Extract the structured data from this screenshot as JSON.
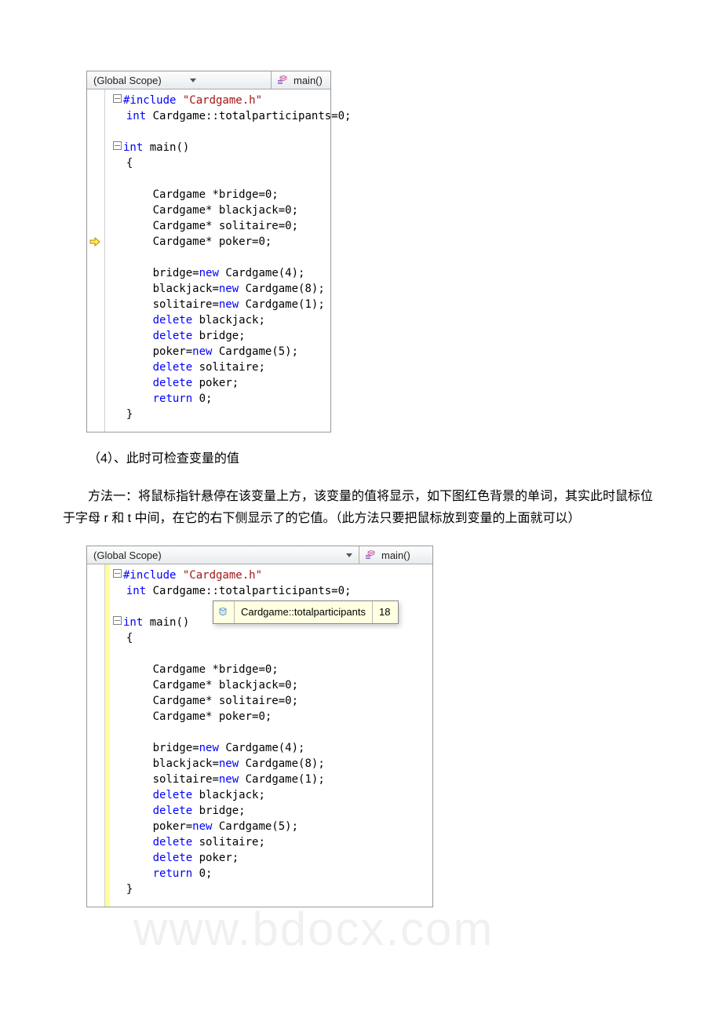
{
  "ide1": {
    "scope": "(Global Scope)",
    "member": "main()",
    "arrow_line": 9,
    "code_lines": [
      {
        "outline": true,
        "spans": [
          {
            "t": "#include ",
            "c": "kw"
          },
          {
            "t": "\"Cardgame.h\"",
            "c": "str"
          }
        ]
      },
      {
        "spans": [
          {
            "t": " ",
            "c": ""
          },
          {
            "t": "int",
            "c": "kw"
          },
          {
            "t": " Cardgame::totalparticipants=0;",
            "c": ""
          }
        ]
      },
      {
        "spans": [
          {
            "t": " ",
            "c": ""
          }
        ]
      },
      {
        "outline": true,
        "spans": [
          {
            "t": "int",
            "c": "kw"
          },
          {
            "t": " main()",
            "c": ""
          }
        ]
      },
      {
        "spans": [
          {
            "t": " {",
            "c": ""
          }
        ]
      },
      {
        "spans": [
          {
            "t": "",
            "c": ""
          }
        ]
      },
      {
        "spans": [
          {
            "t": "     Cardgame *bridge=0;",
            "c": ""
          }
        ]
      },
      {
        "spans": [
          {
            "t": "     Cardgame* blackjack=0;",
            "c": ""
          }
        ]
      },
      {
        "spans": [
          {
            "t": "     Cardgame* solitaire=0;",
            "c": ""
          }
        ]
      },
      {
        "spans": [
          {
            "t": "     Cardgame* poker=0;",
            "c": ""
          }
        ]
      },
      {
        "spans": [
          {
            "t": "",
            "c": ""
          }
        ]
      },
      {
        "spans": [
          {
            "t": "     bridge=",
            "c": ""
          },
          {
            "t": "new",
            "c": "kw"
          },
          {
            "t": " Cardgame(4);",
            "c": ""
          }
        ]
      },
      {
        "spans": [
          {
            "t": "     blackjack=",
            "c": ""
          },
          {
            "t": "new",
            "c": "kw"
          },
          {
            "t": " Cardgame(8);",
            "c": ""
          }
        ]
      },
      {
        "spans": [
          {
            "t": "     solitaire=",
            "c": ""
          },
          {
            "t": "new",
            "c": "kw"
          },
          {
            "t": " Cardgame(1);",
            "c": ""
          }
        ]
      },
      {
        "spans": [
          {
            "t": "     ",
            "c": ""
          },
          {
            "t": "delete",
            "c": "kw"
          },
          {
            "t": " blackjack;",
            "c": ""
          }
        ]
      },
      {
        "spans": [
          {
            "t": "     ",
            "c": ""
          },
          {
            "t": "delete",
            "c": "kw"
          },
          {
            "t": " bridge;",
            "c": ""
          }
        ]
      },
      {
        "spans": [
          {
            "t": "     poker=",
            "c": ""
          },
          {
            "t": "new",
            "c": "kw"
          },
          {
            "t": " Cardgame(5);",
            "c": ""
          }
        ]
      },
      {
        "spans": [
          {
            "t": "     ",
            "c": ""
          },
          {
            "t": "delete",
            "c": "kw"
          },
          {
            "t": " solitaire;",
            "c": ""
          }
        ]
      },
      {
        "spans": [
          {
            "t": "     ",
            "c": ""
          },
          {
            "t": "delete",
            "c": "kw"
          },
          {
            "t": " poker;",
            "c": ""
          }
        ]
      },
      {
        "spans": [
          {
            "t": "     ",
            "c": ""
          },
          {
            "t": "return",
            "c": "kw"
          },
          {
            "t": " 0;",
            "c": ""
          }
        ]
      },
      {
        "spans": [
          {
            "t": " }",
            "c": ""
          }
        ]
      }
    ]
  },
  "para1": "（4）、此时可检查变量的值",
  "para2": "方法一：将鼠标指针悬停在该变量上方，该变量的值将显示，如下图红色背景的单词，其实此时鼠标位于字母 r 和 t 中间，在它的右下侧显示了的它值。（此方法只要把鼠标放到变量的上面就可以）",
  "ide2": {
    "scope": "(Global Scope)",
    "member": "main()",
    "tooltip_text": "Cardgame::totalparticipants",
    "tooltip_val": "18",
    "code_lines": [
      {
        "outline": true,
        "spans": [
          {
            "t": "#include ",
            "c": "kw"
          },
          {
            "t": "\"Cardgame.h\"",
            "c": "str"
          }
        ]
      },
      {
        "spans": [
          {
            "t": " ",
            "c": ""
          },
          {
            "t": "int",
            "c": "kw"
          },
          {
            "t": " Cardgame::totalparticipants=0;",
            "c": ""
          }
        ]
      },
      {
        "spans": [
          {
            "t": " ",
            "c": ""
          }
        ]
      },
      {
        "outline": true,
        "spans": [
          {
            "t": "int",
            "c": "kw"
          },
          {
            "t": " main()",
            "c": ""
          }
        ]
      },
      {
        "spans": [
          {
            "t": " {",
            "c": ""
          }
        ]
      },
      {
        "spans": [
          {
            "t": "",
            "c": ""
          }
        ]
      },
      {
        "spans": [
          {
            "t": "     Cardgame *bridge=0;",
            "c": ""
          }
        ]
      },
      {
        "spans": [
          {
            "t": "     Cardgame* blackjack=0;",
            "c": ""
          }
        ]
      },
      {
        "spans": [
          {
            "t": "     Cardgame* solitaire=0;",
            "c": ""
          }
        ]
      },
      {
        "spans": [
          {
            "t": "     Cardgame* poker=0;",
            "c": ""
          }
        ]
      },
      {
        "spans": [
          {
            "t": "",
            "c": ""
          }
        ]
      },
      {
        "spans": [
          {
            "t": "     bridge=",
            "c": ""
          },
          {
            "t": "new",
            "c": "kw"
          },
          {
            "t": " Cardgame(4);",
            "c": ""
          }
        ]
      },
      {
        "spans": [
          {
            "t": "     blackjack=",
            "c": ""
          },
          {
            "t": "new",
            "c": "kw"
          },
          {
            "t": " Cardgame(8);",
            "c": ""
          }
        ]
      },
      {
        "spans": [
          {
            "t": "     solitaire=",
            "c": ""
          },
          {
            "t": "new",
            "c": "kw"
          },
          {
            "t": " Cardgame(1);",
            "c": ""
          }
        ]
      },
      {
        "spans": [
          {
            "t": "     ",
            "c": ""
          },
          {
            "t": "delete",
            "c": "kw"
          },
          {
            "t": " blackjack;",
            "c": ""
          }
        ]
      },
      {
        "spans": [
          {
            "t": "     ",
            "c": ""
          },
          {
            "t": "delete",
            "c": "kw"
          },
          {
            "t": " bridge;",
            "c": ""
          }
        ]
      },
      {
        "spans": [
          {
            "t": "     poker=",
            "c": ""
          },
          {
            "t": "new",
            "c": "kw"
          },
          {
            "t": " Cardgame(5);",
            "c": ""
          }
        ]
      },
      {
        "spans": [
          {
            "t": "     ",
            "c": ""
          },
          {
            "t": "delete",
            "c": "kw"
          },
          {
            "t": " solitaire;",
            "c": ""
          }
        ]
      },
      {
        "spans": [
          {
            "t": "     ",
            "c": ""
          },
          {
            "t": "delete",
            "c": "kw"
          },
          {
            "t": " poker;",
            "c": ""
          }
        ]
      },
      {
        "spans": [
          {
            "t": "     ",
            "c": ""
          },
          {
            "t": "return",
            "c": "kw"
          },
          {
            "t": " 0;",
            "c": ""
          }
        ]
      },
      {
        "spans": [
          {
            "t": " }",
            "c": ""
          }
        ]
      }
    ]
  },
  "watermark": "www.bdocx.com"
}
